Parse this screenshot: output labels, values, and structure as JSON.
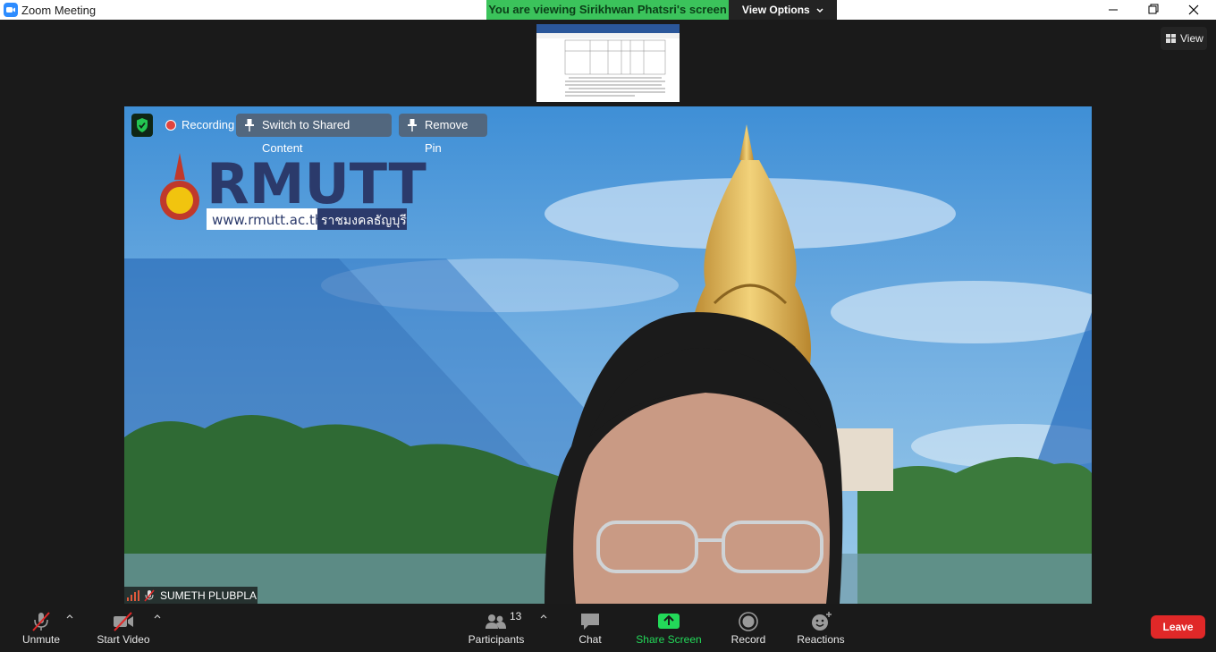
{
  "window": {
    "title": "Zoom Meeting",
    "viewing_banner": "You are viewing Sirikhwan Phatsri's screen",
    "view_options_label": "View Options"
  },
  "top_right": {
    "view_label": "View"
  },
  "video": {
    "recording_label": "Recording",
    "switch_label": "Switch to Shared Content",
    "remove_pin_label": "Remove Pin",
    "participant_name": "SUMETH PLUBPLA",
    "logo_text": "RMUTT",
    "website": "www.rmutt.ac.th",
    "university_thai": "ราชมงคลธัญบุรี"
  },
  "toolbar": {
    "unmute": "Unmute",
    "start_video": "Start Video",
    "participants": "Participants",
    "participants_count": "13",
    "chat": "Chat",
    "share_screen": "Share Screen",
    "record": "Record",
    "reactions": "Reactions",
    "leave": "Leave"
  },
  "colors": {
    "banner_green": "#3bc35b",
    "share_green": "#23d959",
    "leave_red": "#e02828",
    "rmutt_navy": "#2b3a6b"
  },
  "icons": [
    "zoom-logo-icon",
    "chevron-down-icon",
    "minimize-icon",
    "maximize-icon",
    "close-icon",
    "grid-view-icon",
    "shield-check-icon",
    "recording-dot-icon",
    "pin-icon",
    "unpin-icon",
    "signal-icon",
    "mic-muted-icon",
    "microphone-muted-icon",
    "video-off-icon",
    "participants-icon",
    "chat-icon",
    "share-screen-icon",
    "record-icon",
    "reactions-icon"
  ]
}
